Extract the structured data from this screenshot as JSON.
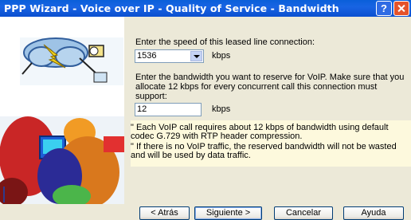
{
  "window": {
    "title": "PPP Wizard - Voice over IP - Quality of Service - Bandwidth",
    "help_glyph": "?"
  },
  "form": {
    "speed_prompt": "Enter the speed of this leased line connection:",
    "speed_value": "1536",
    "speed_unit": "kbps",
    "voip_prompt": "Enter the bandwidth you want to reserve for VoIP. Make sure that you allocate 12 kbps for every concurrent call this connection must support:",
    "voip_value": "12",
    "voip_unit": "kbps"
  },
  "notes": [
    "\" Each VoIP call requires about 12 kbps of bandwidth using default codec G.729 with RTP header compression.",
    "\" If there is no VoIP traffic, the reserved bandwidth will not be wasted and will be used by data traffic."
  ],
  "buttons": {
    "back": "< Atrás",
    "next": "Siguiente >",
    "cancel": "Cancelar",
    "help": "Ayuda"
  },
  "colors": {
    "titlebar": "#0b4fd0",
    "dialog_bg": "#ece9d8",
    "note_bg": "#fdf9dd"
  }
}
